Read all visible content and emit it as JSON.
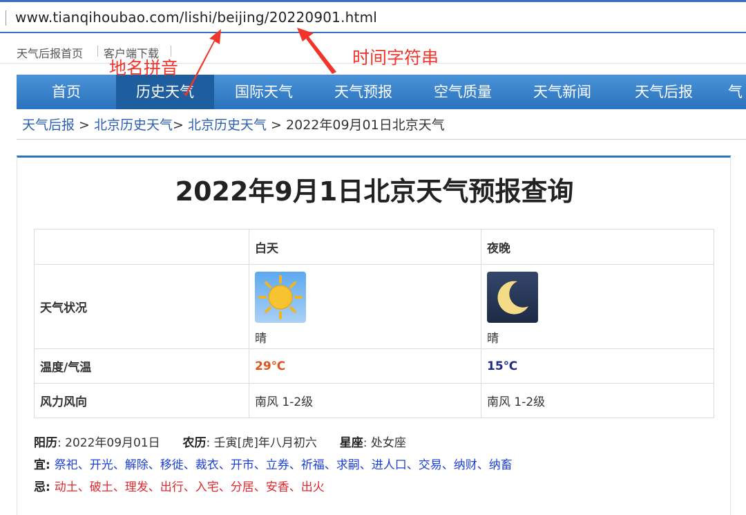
{
  "browser": {
    "url": "www.tianqihoubao.com/lishi/beijing/20220901.html"
  },
  "toplinks": [
    "天气后报首页",
    "客户端下载"
  ],
  "nav": [
    "首页",
    "历史天气",
    "国际天气",
    "天气预报",
    "空气质量",
    "天气新闻",
    "天气后报",
    "气"
  ],
  "breadcrumb": {
    "home": "天气后报",
    "sep1": " > ",
    "l2": "北京历史天气",
    "sep2": "> ",
    "l3": "北京历史天气",
    "current": " > 2022年09月01日北京天气"
  },
  "title": "2022年9月1日北京天气预报查询",
  "table": {
    "col_day": "白天",
    "col_night": "夜晚",
    "row_condition": "天气状况",
    "day_condition": "晴",
    "night_condition": "晴",
    "row_temp": "温度/气温",
    "day_temp": "29℃",
    "night_temp": "15℃",
    "row_wind": "风力风向",
    "day_wind": "南风 1-2级",
    "night_wind": "南风 1-2级"
  },
  "icons": {
    "day": "sun-icon",
    "night": "crescent-moon-icon"
  },
  "info": {
    "solar_label": "阳历",
    "solar_value": ": 2022年09月01日",
    "lunar_label": "农历",
    "lunar_value": ": 壬寅[虎]年八月初六",
    "zodiac_label": "星座",
    "zodiac_value": ": 处女座",
    "yi_label": "宜",
    "yi_value": "祭祀、开光、解除、移徙、裁衣、开市、立券、祈福、求嗣、进人口、交易、纳财、纳畜",
    "ji_label": "忌",
    "ji_value": "动土、破土、理发、出行、入宅、分居、安香、出火"
  },
  "annotations": {
    "pinyin": "地名拼音",
    "timestring": "时间字符串"
  },
  "colors": {
    "nav": "#2a73bd",
    "annotation": "#f1352a",
    "good": "#1c3fd6",
    "bad": "#e0282d",
    "day_temp": "#e0531f",
    "night_temp": "#1b2b86"
  }
}
